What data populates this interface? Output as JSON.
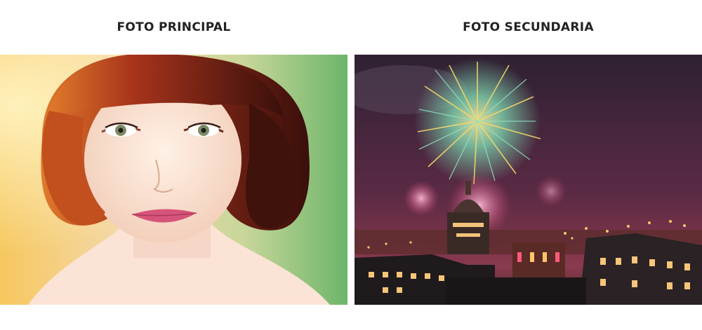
{
  "main_photo": {
    "title": "FOTO PRINCIPAL"
  },
  "secondary_photo": {
    "title": "FOTO SECUNDARIA"
  }
}
